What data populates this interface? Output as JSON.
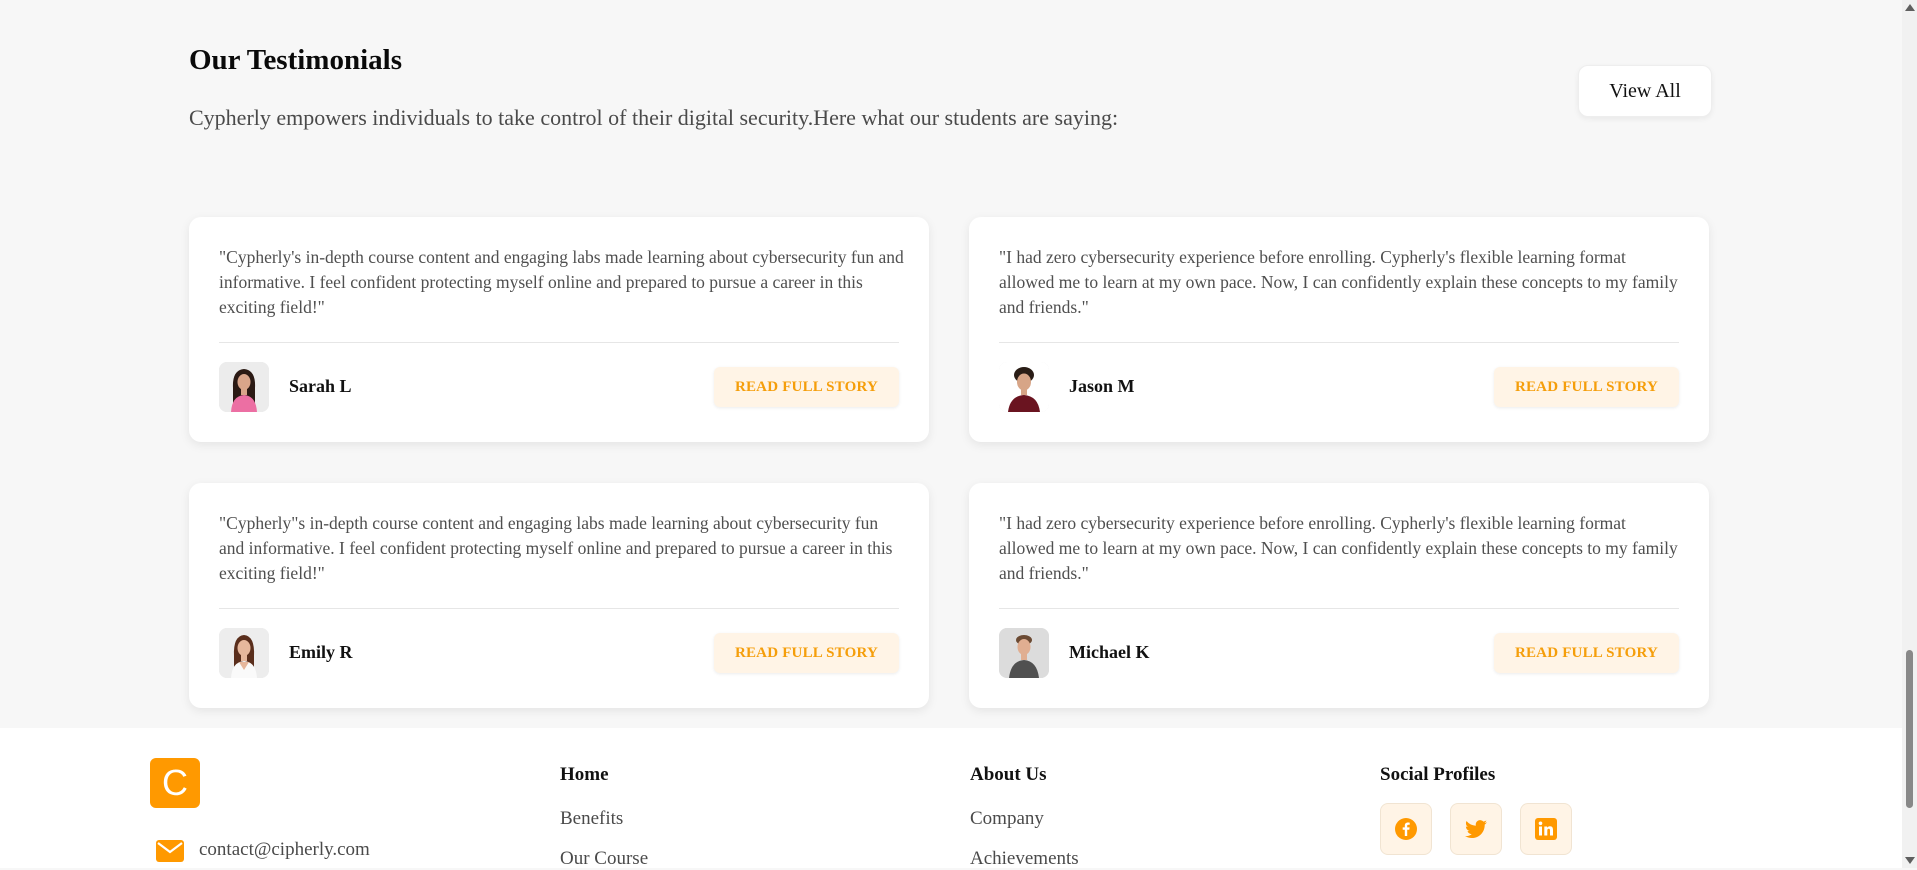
{
  "testimonials": {
    "title": "Our Testimonials",
    "subtitle": "Cypherly empowers individuals to take control of their digital security.Here what our students are saying:",
    "view_all_label": "View All",
    "cards": [
      {
        "quote": "\"Cypherly's in-depth course content and engaging labs made learning about cybersecurity fun and informative. I feel confident protecting myself online and prepared to pursue a career in this exciting field!\"",
        "name": "Sarah L",
        "button_label": "READ FULL STORY",
        "avatar": "woman-pink-top-avatar"
      },
      {
        "quote": "\"I had zero cybersecurity experience before enrolling. Cypherly's flexible learning format allowed me to learn at my own pace. Now, I can confidently explain these concepts to my family and friends.\"",
        "name": "Jason M",
        "button_label": "READ FULL STORY",
        "avatar": "man-curly-hair-avatar"
      },
      {
        "quote": "\"Cypherly\"s in-depth course content and engaging labs made learning about cybersecurity fun and informative. I feel confident protecting myself online and prepared to pursue a career in this exciting field!\"",
        "name": "Emily R",
        "button_label": "READ FULL STORY",
        "avatar": "woman-long-hair-avatar"
      },
      {
        "quote": "\"I had zero cybersecurity experience before enrolling. Cypherly's flexible learning format allowed me to learn at my own pace. Now, I can confidently explain these concepts to my family and friends.\"",
        "name": "Michael K",
        "button_label": "READ FULL STORY",
        "avatar": "man-grey-shirt-avatar"
      }
    ]
  },
  "footer": {
    "logo_letter": "C",
    "email": "contact@cipherly.com",
    "columns": [
      {
        "title": "Home",
        "links": [
          "Benefits",
          "Our Course"
        ]
      },
      {
        "title": "About Us",
        "links": [
          "Company",
          "Achievements"
        ]
      }
    ],
    "social": {
      "title": "Social Profiles",
      "icons": [
        "facebook-icon",
        "twitter-icon",
        "linkedin-icon"
      ]
    }
  },
  "colors": {
    "accent": "#ff9900",
    "button_text": "#f59e0b",
    "button_bg": "#fff4e6",
    "page_bg": "#f7f7f7"
  }
}
